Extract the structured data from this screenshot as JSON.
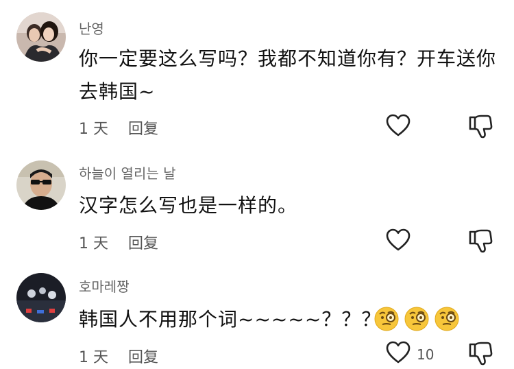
{
  "comments": [
    {
      "username": "난영",
      "text": "你一定要这么写吗？我都不知道你有？开车送你去韩国~",
      "time": "1 天",
      "reply_label": "回复",
      "avatar_icon": "user-avatar-couple",
      "like_icon": "heart-outline-icon",
      "dislike_icon": "thumbs-down-outline-icon"
    },
    {
      "username": "하늘이 열리는 날",
      "text": "汉字怎么写也是一样的。",
      "time": "1 天",
      "reply_label": "回复",
      "avatar_icon": "user-avatar-man-sunglasses",
      "like_icon": "heart-outline-icon",
      "dislike_icon": "thumbs-down-outline-icon"
    },
    {
      "username": "호마레짱",
      "text": "韩国人不用那个词~~~~~？？？",
      "emojis": [
        "face-with-monocle",
        "face-with-monocle",
        "face-with-monocle"
      ],
      "time": "1 天",
      "reply_label": "回复",
      "like_count": "10",
      "avatar_icon": "user-avatar-dark-scene",
      "like_icon": "heart-outline-icon",
      "dislike_icon": "thumbs-down-outline-icon"
    }
  ]
}
